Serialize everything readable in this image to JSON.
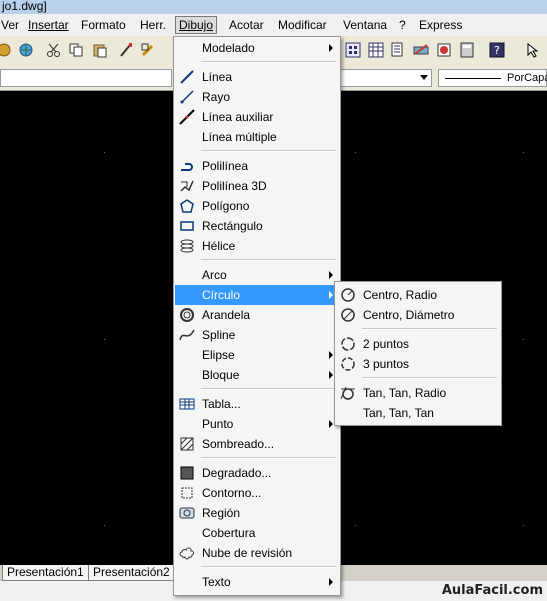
{
  "window": {
    "title": "jo1.dwg]"
  },
  "menubar": {
    "items": [
      {
        "label": "Ver"
      },
      {
        "label": "Insertar"
      },
      {
        "label": "Formato"
      },
      {
        "label": "Herr."
      },
      {
        "label": "Dibujo"
      },
      {
        "label": "Acotar"
      },
      {
        "label": "Modificar"
      },
      {
        "label": "Ventana"
      },
      {
        "label": "?"
      },
      {
        "label": "Express"
      }
    ]
  },
  "properties_bar": {
    "linetype": "PorCapa"
  },
  "dibujo_menu": {
    "items": [
      {
        "label": "Modelado",
        "icon": "none",
        "submenu": true
      },
      {
        "label": "Línea",
        "icon": "line-icon"
      },
      {
        "label": "Rayo",
        "icon": "ray-icon"
      },
      {
        "label": "Línea auxiliar",
        "icon": "construction-line-icon"
      },
      {
        "label": "Línea múltiple",
        "icon": "none"
      },
      {
        "label": "Polilínea",
        "icon": "polyline-icon"
      },
      {
        "label": "Polilínea 3D",
        "icon": "polyline-3d-icon"
      },
      {
        "label": "Polígono",
        "icon": "polygon-icon"
      },
      {
        "label": "Rectángulo",
        "icon": "rectangle-icon"
      },
      {
        "label": "Hélice",
        "icon": "helix-icon"
      },
      {
        "label": "Arco",
        "icon": "none",
        "submenu": true
      },
      {
        "label": "Círculo",
        "icon": "none",
        "submenu": true,
        "highlighted": true
      },
      {
        "label": "Arandela",
        "icon": "donut-icon"
      },
      {
        "label": "Spline",
        "icon": "spline-icon"
      },
      {
        "label": "Elipse",
        "icon": "none",
        "submenu": true
      },
      {
        "label": "Bloque",
        "icon": "none",
        "submenu": true
      },
      {
        "label": "Tabla...",
        "icon": "table-icon"
      },
      {
        "label": "Punto",
        "icon": "none",
        "submenu": true
      },
      {
        "label": "Sombreado...",
        "icon": "hatch-icon"
      },
      {
        "label": "Degradado...",
        "icon": "gradient-icon"
      },
      {
        "label": "Contorno...",
        "icon": "boundary-icon"
      },
      {
        "label": "Región",
        "icon": "region-icon"
      },
      {
        "label": "Cobertura",
        "icon": "none"
      },
      {
        "label": "Nube de revisión",
        "icon": "revision-cloud-icon"
      },
      {
        "label": "Texto",
        "icon": "none",
        "submenu": true
      }
    ]
  },
  "circulo_menu": {
    "items": [
      {
        "label": "Centro, Radio",
        "icon": "circle-center-radius-icon"
      },
      {
        "label": "Centro, Diámetro",
        "icon": "circle-center-diameter-icon"
      },
      {
        "label": "2 puntos",
        "icon": "circle-2-points-icon"
      },
      {
        "label": "3 puntos",
        "icon": "circle-3-points-icon"
      },
      {
        "label": "Tan, Tan, Radio",
        "icon": "circle-tan-tan-radius-icon"
      },
      {
        "label": "Tan, Tan, Tan",
        "icon": "none"
      }
    ]
  },
  "layout_tabs": [
    {
      "label": "Presentación1"
    },
    {
      "label": "Presentación2"
    }
  ],
  "branding": {
    "logo_text": "AulaFacil.com"
  },
  "colors": {
    "highlight": "#3399ff",
    "canvas": "#000000",
    "menu_bg": "#f5f5f5"
  }
}
